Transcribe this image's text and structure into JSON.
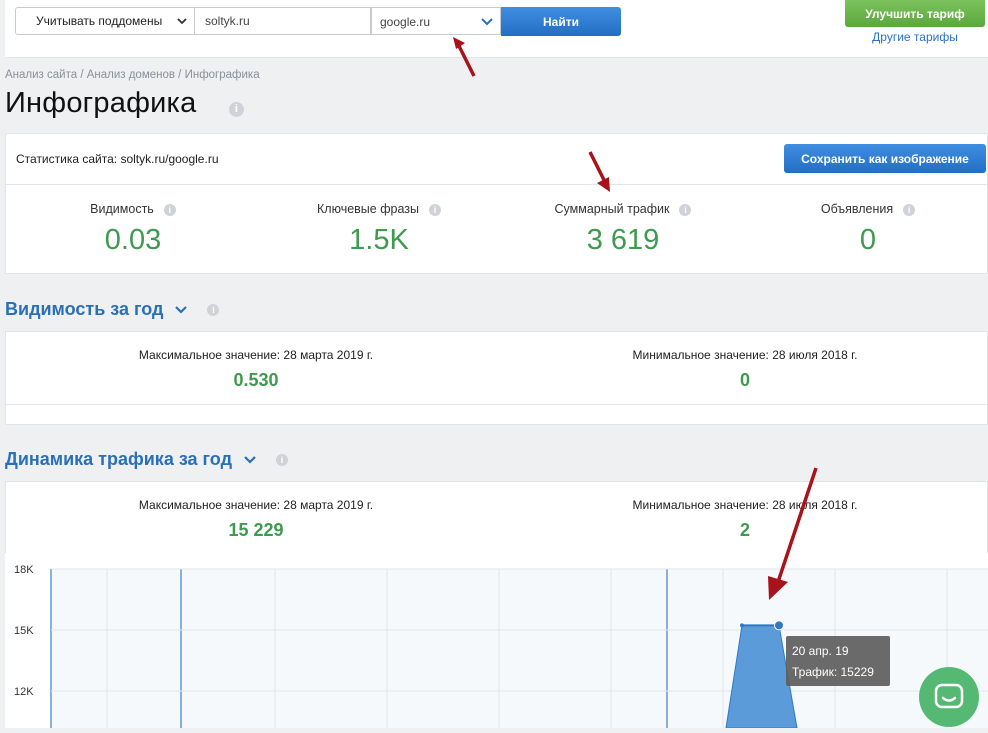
{
  "toolbar": {
    "subdomains_label": "Учитывать поддомены",
    "domain_value": "soltyk.ru",
    "engine_value": "google.ru",
    "find_label": "Найти",
    "upgrade_label": "Улучшить тариф",
    "other_tariffs_label": "Другие тарифы"
  },
  "breadcrumb": "Анализ сайта / Анализ доменов / Инфографика",
  "page_title": "Инфографика",
  "stats": {
    "label": "Статистика сайта: soltyk.ru/google.ru",
    "save_label": "Сохранить как изображение",
    "metrics": [
      {
        "title": "Видимость",
        "value": "0.03"
      },
      {
        "title": "Ключевые фразы",
        "value": "1.5K"
      },
      {
        "title": "Суммарный трафик",
        "value": "3 619"
      },
      {
        "title": "Объявления",
        "value": "0"
      }
    ]
  },
  "visibility": {
    "title": "Видимость за год",
    "max_label": "Максимальное значение: 28 марта 2019 г.",
    "max_value": "0.530",
    "min_label": "Минимальное значение: 28 июля 2018 г.",
    "min_value": "0"
  },
  "traffic": {
    "title": "Динамика трафика за год",
    "max_label": "Максимальное значение: 28 марта 2019 г.",
    "max_value": "15 229",
    "min_label": "Минимальное значение: 28 июля 2018 г.",
    "min_value": "2"
  },
  "chart_data": {
    "type": "area",
    "y_ticks": [
      "18K",
      "15K",
      "12K"
    ],
    "ylim": [
      10000,
      18000
    ],
    "x": [
      0,
      1,
      2,
      3
    ],
    "values": [
      0,
      15229,
      15229,
      0
    ],
    "tooltip": {
      "date": "20 апр. 19",
      "label": "Трафик: 15229"
    },
    "grid": true,
    "colors": {
      "area": "#5b9bd9",
      "line": "#2f79c4",
      "grid": "#dfe5ea"
    }
  },
  "colors": {
    "accent": "#2b6fb6",
    "value_green": "#3d9a4e",
    "annotation": "#a7121b"
  }
}
